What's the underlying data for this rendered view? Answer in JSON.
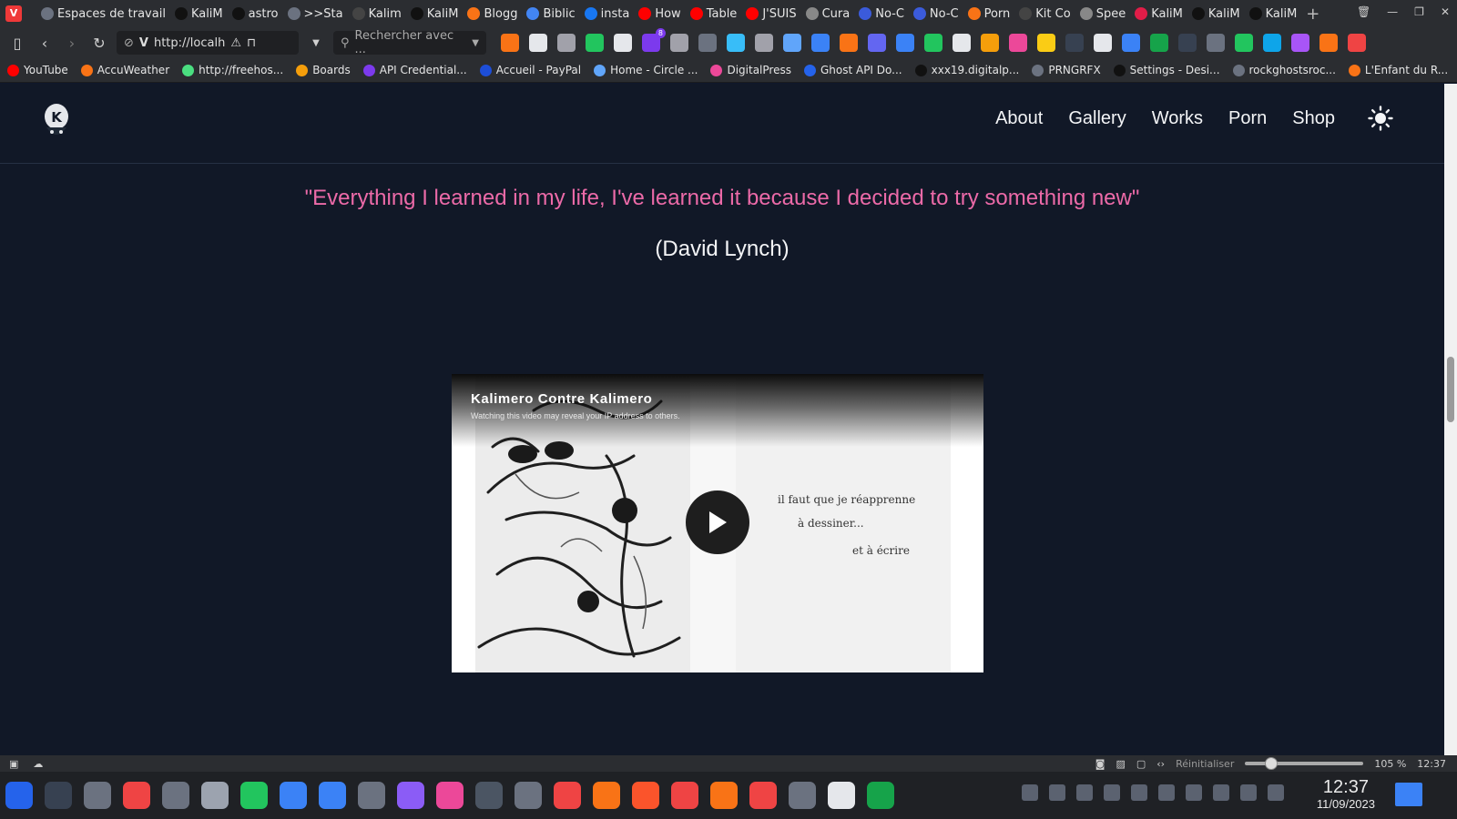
{
  "browser": {
    "tabs": [
      {
        "label": "Espaces de travail",
        "color": "#6b7280"
      },
      {
        "label": "KaliM",
        "color": "#111111"
      },
      {
        "label": "astro",
        "color": "#111111"
      },
      {
        "label": ">>Sta",
        "color": "#6b7280"
      },
      {
        "label": "Kalim",
        "color": "#444444"
      },
      {
        "label": "KaliM",
        "color": "#111111"
      },
      {
        "label": "Blogg",
        "color": "#f97316"
      },
      {
        "label": "Biblic",
        "color": "#4285f4"
      },
      {
        "label": "insta",
        "color": "#1877f2"
      },
      {
        "label": "How",
        "color": "#ff0000"
      },
      {
        "label": "Table",
        "color": "#ff0000"
      },
      {
        "label": "J'SUIS",
        "color": "#ff0000"
      },
      {
        "label": "Cura",
        "color": "#888888"
      },
      {
        "label": "No-C",
        "color": "#3b5bdb"
      },
      {
        "label": "No-C",
        "color": "#3b5bdb"
      },
      {
        "label": "Porn",
        "color": "#f97316"
      },
      {
        "label": "Kit Co",
        "color": "#444444"
      },
      {
        "label": "Spee",
        "color": "#888888"
      },
      {
        "label": "KaliM",
        "color": "#e11d48"
      },
      {
        "label": "KaliM",
        "color": "#111111"
      },
      {
        "label": "KaliM",
        "color": "#111111"
      }
    ],
    "url": "http://localh",
    "search_placeholder": "Rechercher avec ...",
    "bookmarks": [
      {
        "label": "YouTube",
        "color": "#ff0000"
      },
      {
        "label": "AccuWeather",
        "color": "#f97316"
      },
      {
        "label": "http://freehos...",
        "color": "#4ade80"
      },
      {
        "label": "Boards",
        "color": "#f59e0b"
      },
      {
        "label": "API Credential...",
        "color": "#7c3aed"
      },
      {
        "label": "Accueil - PayPal",
        "color": "#1d4ed8"
      },
      {
        "label": "Home - Circle ...",
        "color": "#60a5fa"
      },
      {
        "label": "DigitalPress",
        "color": "#ec4899"
      },
      {
        "label": "Ghost API Do...",
        "color": "#2563eb"
      },
      {
        "label": "xxx19.digitalp...",
        "color": "#111111"
      },
      {
        "label": "PRNGRFX",
        "color": "#6b7280"
      },
      {
        "label": "Settings - Desi...",
        "color": "#111111"
      },
      {
        "label": "rockghostsroc...",
        "color": "#6b7280"
      },
      {
        "label": "L'Enfant du R...",
        "color": "#f97316"
      }
    ],
    "extension_colors": [
      "#f97316",
      "#e5e7eb",
      "#a1a1aa",
      "#22c55e",
      "#e5e7eb",
      "#7c3aed",
      "#a1a1aa",
      "#6b7280",
      "#38bdf8",
      "#a1a1aa",
      "#60a5fa",
      "#3b82f6",
      "#f97316",
      "#6366f1",
      "#3b82f6",
      "#22c55e",
      "#e5e7eb",
      "#f59e0b",
      "#ec4899",
      "#facc15",
      "#374151",
      "#e5e7eb",
      "#3b82f6",
      "#16a34a",
      "#374151",
      "#6b7280",
      "#22c55e",
      "#0ea5e9",
      "#a855f7",
      "#f97316",
      "#ef4444"
    ],
    "extension_badge": "8"
  },
  "site": {
    "nav": [
      "About",
      "Gallery",
      "Works",
      "Porn",
      "Shop"
    ],
    "quote": "\"Everything I learned in my life, I've learned it because I decided to try something new\"",
    "author": "(David Lynch)",
    "video": {
      "title": "Kalimero Contre Kalimero",
      "notice": "Watching this video may reveal your IP address to others.",
      "handwriting": [
        "il faut que je réapprenne",
        "à dessiner...",
        "et à écrire"
      ]
    }
  },
  "statusbar": {
    "reset_label": "Réinitialiser",
    "zoom": "105 %",
    "time": "12:37"
  },
  "taskbar": {
    "time": "12:37",
    "date": "11/09/2023",
    "app_colors": [
      "#2563eb",
      "#374151",
      "#6b7280",
      "#ef4444",
      "#6b7280",
      "#9ca3af",
      "#22c55e",
      "#3b82f6",
      "#3b82f6",
      "#6b7280",
      "#8b5cf6",
      "#ec4899",
      "#4b5563",
      "#6b7280",
      "#ef4444",
      "#f97316",
      "#fb542b",
      "#ef4444",
      "#f97316",
      "#ef4444",
      "#6b7280",
      "#e5e7eb",
      "#16a34a"
    ]
  }
}
